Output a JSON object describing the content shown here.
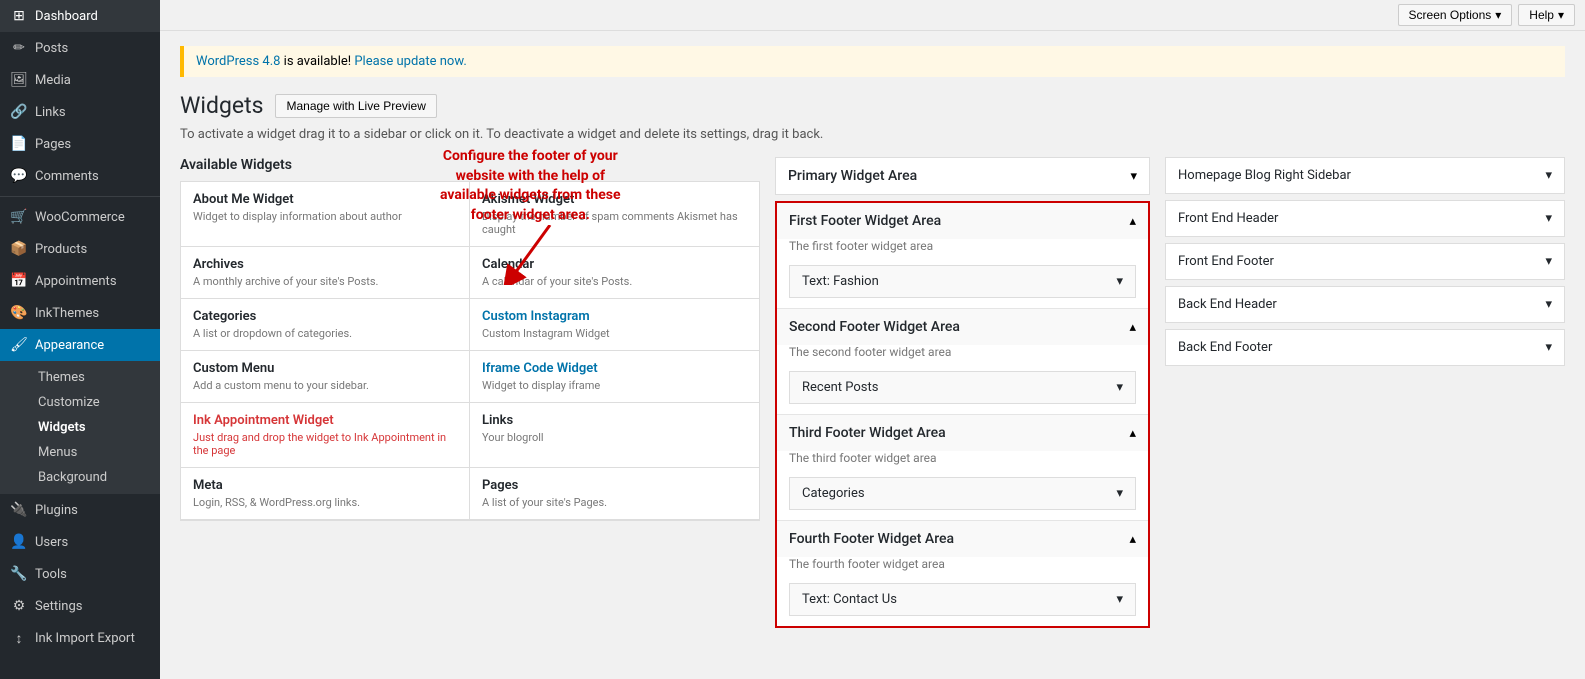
{
  "topbar": {
    "screen_options": "Screen Options",
    "help": "Help"
  },
  "sidebar": {
    "items": [
      {
        "id": "dashboard",
        "label": "Dashboard",
        "icon": "⊞"
      },
      {
        "id": "posts",
        "label": "Posts",
        "icon": "✏"
      },
      {
        "id": "media",
        "label": "Media",
        "icon": "🖼"
      },
      {
        "id": "links",
        "label": "Links",
        "icon": "🔗"
      },
      {
        "id": "pages",
        "label": "Pages",
        "icon": "📄"
      },
      {
        "id": "comments",
        "label": "Comments",
        "icon": "💬"
      },
      {
        "id": "woocommerce",
        "label": "WooCommerce",
        "icon": "🛒"
      },
      {
        "id": "products",
        "label": "Products",
        "icon": "📦"
      },
      {
        "id": "appointments",
        "label": "Appointments",
        "icon": "📅"
      },
      {
        "id": "inkthemes",
        "label": "InkThemes",
        "icon": "🎨"
      },
      {
        "id": "appearance",
        "label": "Appearance",
        "icon": "🖌"
      },
      {
        "id": "plugins",
        "label": "Plugins",
        "icon": "🔌"
      },
      {
        "id": "users",
        "label": "Users",
        "icon": "👤"
      },
      {
        "id": "tools",
        "label": "Tools",
        "icon": "🔧"
      },
      {
        "id": "settings",
        "label": "Settings",
        "icon": "⚙"
      },
      {
        "id": "ink-import-export",
        "label": "Ink Import Export",
        "icon": "↕"
      }
    ],
    "appearance_sub": [
      {
        "id": "themes",
        "label": "Themes"
      },
      {
        "id": "customize",
        "label": "Customize"
      },
      {
        "id": "widgets",
        "label": "Widgets",
        "active": true
      },
      {
        "id": "menus",
        "label": "Menus"
      },
      {
        "id": "background",
        "label": "Background"
      }
    ]
  },
  "page": {
    "title": "Widgets",
    "live_preview_btn": "Manage with Live Preview",
    "desc": "To activate a widget drag it to a sidebar or click on it. To deactivate a widget and delete its settings, drag it back.",
    "available_widgets_title": "Available Widgets",
    "update_notice": " is available! ",
    "wp_version": "WordPress 4.8",
    "update_link": "Please update now."
  },
  "annotation": {
    "text": "Configure the footer of your\nwebsite with the help of\navailable widgets from these\nfooter widget area."
  },
  "widgets": [
    {
      "name": "About Me Widget",
      "desc": "Widget to display information about author",
      "style": "normal"
    },
    {
      "name": "Akismet Widget",
      "desc": "Display the number of spam comments Akismet has caught",
      "style": "normal"
    },
    {
      "name": "Archives",
      "desc": "A monthly archive of your site's Posts.",
      "style": "normal"
    },
    {
      "name": "Calendar",
      "desc": "A calendar of your site's Posts.",
      "style": "normal"
    },
    {
      "name": "Categories",
      "desc": "A list or dropdown of categories.",
      "style": "normal"
    },
    {
      "name": "Custom Instagram",
      "desc": "Custom Instagram Widget",
      "style": "blue"
    },
    {
      "name": "Custom Menu",
      "desc": "Add a custom menu to your sidebar.",
      "style": "normal"
    },
    {
      "name": "Iframe Code Widget",
      "desc": "Widget to display iframe",
      "style": "blue"
    },
    {
      "name": "Ink Appointment Widget",
      "desc": "Just drag and drop the widget to Ink Appointment in the page",
      "style": "orange"
    },
    {
      "name": "Links",
      "desc": "Your blogroll",
      "style": "normal"
    },
    {
      "name": "Meta",
      "desc": "Login, RSS, & WordPress.org links.",
      "style": "normal"
    },
    {
      "name": "Pages",
      "desc": "A list of your site's Pages.",
      "style": "normal"
    }
  ],
  "primary_area": {
    "title": "Primary Widget Area",
    "collapsed": true
  },
  "footer_areas": [
    {
      "title": "First Footer Widget Area",
      "desc": "The first footer widget area",
      "widget": "Text: Fashion"
    },
    {
      "title": "Second Footer Widget Area",
      "desc": "The second footer widget area",
      "widget": "Recent Posts"
    },
    {
      "title": "Third Footer Widget Area",
      "desc": "The third footer widget area",
      "widget": "Categories"
    },
    {
      "title": "Fourth Footer Widget Area",
      "desc": "The fourth footer widget area",
      "widget": "Text: Contact Us"
    }
  ],
  "right_panel": [
    {
      "label": "Homepage Blog Right Sidebar"
    },
    {
      "label": "Front End Header"
    },
    {
      "label": "Front End Footer"
    },
    {
      "label": "Back End Header"
    },
    {
      "label": "Back End Footer"
    }
  ]
}
